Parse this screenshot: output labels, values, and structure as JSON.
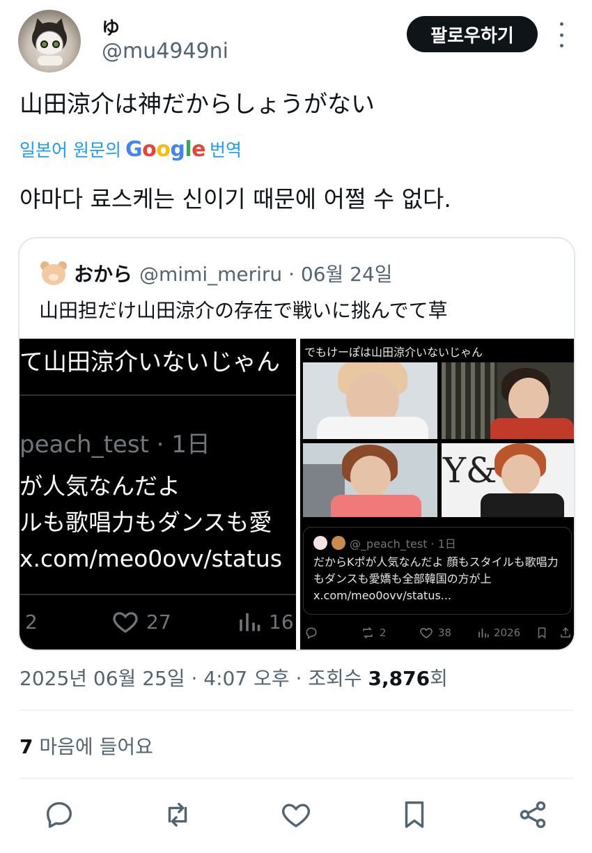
{
  "author": {
    "display_name": "ゆ",
    "handle": "@mu4949ni",
    "follow_label": "팔로우하기"
  },
  "tweet": {
    "text": "山田涼介は神だからしょうがない",
    "translate_prefix": "일본어 원문의",
    "translate_brand": "Google",
    "translate_suffix": "번역",
    "translated_text": "야마다 료스케는 신이기 때문에 어쩔 수 없다."
  },
  "quoted": {
    "name": "おから",
    "meta": "@mimi_meriru · 06월 24일",
    "text": "山田担だけ山田涼介の存在で戦いに挑んでて草",
    "left_media": {
      "line1": "て山田涼介いないじゃん",
      "handle": "peach_test · 1日",
      "body_line1": "が人気なんだよ",
      "body_line2": "ルも歌唱力もダンスも愛",
      "body_line3": "x.com/meo0ovv/status",
      "reply_count": "2",
      "like_count": "27",
      "view_count": "16"
    },
    "right_media": {
      "top_text": "でもけーぽは山田涼介いないじゃん",
      "embed_handle": "@_peach_test · 1日",
      "embed_body": "だからKポが人気なんだよ 顔もスタイルも歌唱力もダンスも愛嬌も全部韓国の方が上 x.com/meo0ovv/status...",
      "photo_text": "Y&O.",
      "retweet_count": "2",
      "like_count": "38",
      "view_count": "2026"
    }
  },
  "footer": {
    "timestamp": "2025년 06월 25일 · 4:07 오후 · 조회수",
    "views": "3,876",
    "views_suffix": "회",
    "like_count": "7",
    "likes_label": "마음에 들어요"
  }
}
